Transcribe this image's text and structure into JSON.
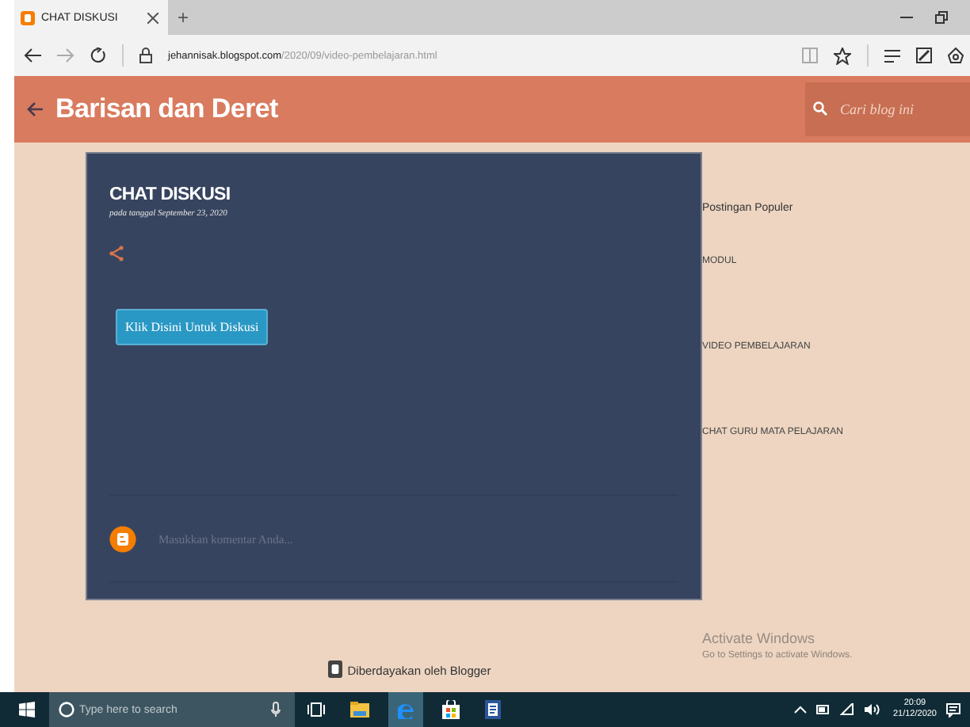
{
  "browser": {
    "tab": {
      "title": "CHAT DISKUSI"
    },
    "new_tab": "+",
    "address": {
      "domain": "jehannisak.blogspot.com",
      "path": "/2020/09/video-pembelajaran.html"
    }
  },
  "blog": {
    "title": "Barisan dan Deret",
    "search": {
      "placeholder": "Cari blog ini"
    }
  },
  "post": {
    "title": "CHAT DISKUSI",
    "date": "pada tanggal September 23, 2020",
    "button": "Klik Disini Untuk Diskusi",
    "comment": {
      "placeholder": "Masukkan komentar Anda..."
    }
  },
  "sidebar": {
    "heading": "Postingan Populer",
    "items": [
      {
        "label": "MODUL"
      },
      {
        "label": "VIDEO PEMBELAJARAN"
      },
      {
        "label": "CHAT GURU MATA PELAJARAN"
      }
    ]
  },
  "footer": "Diberdayakan oleh Blogger",
  "activation": {
    "title": "Activate Windows",
    "subtitle": "Go to Settings to activate Windows."
  },
  "taskbar": {
    "search": {
      "placeholder": "Type here to search"
    },
    "time": "20:09",
    "date": "21/12/2020"
  }
}
